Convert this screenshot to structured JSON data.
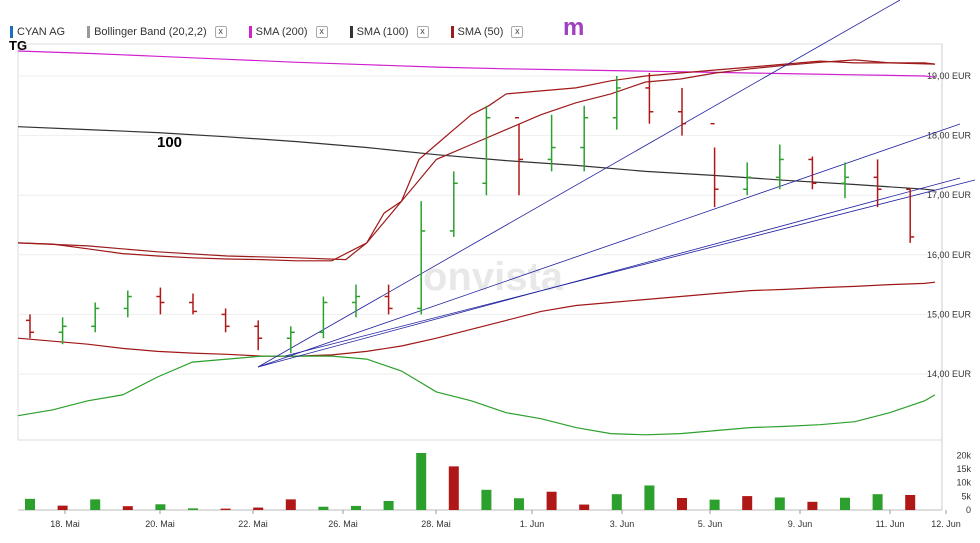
{
  "legend": {
    "ticker": {
      "label": "CYAN AG",
      "color": "#1a6fc4"
    },
    "bollinger": {
      "label": "Bollinger Band (20,2,2)",
      "color": "#999999",
      "close": "x"
    },
    "sma200": {
      "label": "SMA (200)",
      "color": "#d020d0",
      "close": "x"
    },
    "sma100": {
      "label": "SMA (100)",
      "color": "#333333",
      "close": "x"
    },
    "sma50": {
      "label": "SMA (50)",
      "color": "#9b1c1c",
      "close": "x"
    }
  },
  "logo_text": "m",
  "watermark": "onvista",
  "annotations": {
    "tg": "TG",
    "sma100_label": "100"
  },
  "chart_data": {
    "type": "ohlc",
    "x": [
      "16.05",
      "17.05",
      "18.05",
      "19.05",
      "20.05",
      "21.05",
      "22.05",
      "23.05",
      "24.05",
      "25.05",
      "26.05",
      "27.05",
      "28.05",
      "29.05",
      "30.05",
      "31.05",
      "01.06",
      "02.06",
      "03.06",
      "04.06",
      "05.06",
      "06.06",
      "07.06",
      "08.06",
      "09.06",
      "10.06",
      "11.06",
      "12.06"
    ],
    "x_ticks": [
      "18. Mai",
      "20. Mai",
      "22. Mai",
      "26. Mai",
      "28. Mai",
      "1. Jun",
      "3. Jun",
      "5. Jun",
      "9. Jun",
      "11. Jun",
      "12. Jun"
    ],
    "y_ticks": [
      "19,00 EUR",
      "18,00 EUR",
      "17,00 EUR",
      "16,00 EUR",
      "15,00 EUR",
      "14,00 EUR"
    ],
    "ylim": [
      13.0,
      19.3
    ],
    "volume_ticks": [
      "20k",
      "15k",
      "10k",
      "5k",
      "0"
    ],
    "volume_ylim": [
      0,
      22000
    ],
    "colors": {
      "up": "#2ca02c",
      "down": "#b01818"
    },
    "series": [
      {
        "name": "SMA (200)",
        "color": "#d020d0",
        "values": [
          [
            16.0,
            19.42
          ],
          [
            18.0,
            19.38
          ],
          [
            20.0,
            19.33
          ],
          [
            22.0,
            19.28
          ],
          [
            24.0,
            19.23
          ],
          [
            26.0,
            19.19
          ],
          [
            28.0,
            19.15
          ],
          [
            30.0,
            19.12
          ],
          [
            1.0,
            19.1
          ],
          [
            3.0,
            19.08
          ],
          [
            5.0,
            19.06
          ],
          [
            7.0,
            19.04
          ],
          [
            9.0,
            19.02
          ],
          [
            11.0,
            19.0
          ],
          [
            11.3,
            18.98
          ]
        ]
      },
      {
        "name": "SMA (100)",
        "color": "#333333",
        "values": [
          [
            16.0,
            18.15
          ],
          [
            18.0,
            18.1
          ],
          [
            20.0,
            18.05
          ],
          [
            22.0,
            17.98
          ],
          [
            24.0,
            17.9
          ],
          [
            26.0,
            17.8
          ],
          [
            28.0,
            17.68
          ],
          [
            30.0,
            17.58
          ],
          [
            1.0,
            17.5
          ],
          [
            3.0,
            17.4
          ],
          [
            5.0,
            17.33
          ],
          [
            7.0,
            17.25
          ],
          [
            9.0,
            17.18
          ],
          [
            11.0,
            17.1
          ],
          [
            11.3,
            17.08
          ]
        ]
      },
      {
        "name": "SMA (50)",
        "color": "#9b1c1c",
        "values": [
          [
            16.0,
            16.2
          ],
          [
            18.0,
            16.15
          ],
          [
            20.0,
            16.05
          ],
          [
            22.0,
            15.98
          ],
          [
            24.0,
            15.95
          ],
          [
            25.4,
            15.92
          ],
          [
            26.0,
            16.2
          ],
          [
            27.0,
            16.9
          ],
          [
            28.0,
            17.6
          ],
          [
            29.0,
            17.85
          ],
          [
            30.0,
            18.1
          ],
          [
            31.0,
            18.35
          ],
          [
            1.0,
            18.55
          ],
          [
            2.0,
            18.7
          ],
          [
            3.0,
            18.9
          ],
          [
            4.0,
            18.95
          ],
          [
            5.0,
            19.05
          ],
          [
            6.0,
            19.12
          ],
          [
            7.0,
            19.18
          ],
          [
            8.0,
            19.23
          ],
          [
            9.0,
            19.27
          ],
          [
            10.0,
            19.22
          ],
          [
            11.0,
            19.22
          ],
          [
            11.3,
            19.2
          ]
        ]
      },
      {
        "name": "Bollinger Upper",
        "color": "#a01818",
        "values": [
          [
            16.0,
            16.2
          ],
          [
            17.0,
            16.18
          ],
          [
            18.0,
            16.1
          ],
          [
            19.0,
            16.02
          ],
          [
            20.0,
            15.98
          ],
          [
            21.0,
            15.95
          ],
          [
            22.0,
            15.93
          ],
          [
            23.0,
            15.92
          ],
          [
            24.0,
            15.9
          ],
          [
            25.0,
            15.9
          ],
          [
            26.0,
            16.2
          ],
          [
            26.5,
            16.7
          ],
          [
            27.0,
            16.9
          ],
          [
            27.5,
            17.6
          ],
          [
            28.0,
            17.85
          ],
          [
            28.5,
            18.1
          ],
          [
            29.0,
            18.35
          ],
          [
            29.5,
            18.5
          ],
          [
            30.0,
            18.7
          ],
          [
            31.0,
            18.75
          ],
          [
            1.0,
            18.8
          ],
          [
            2.0,
            18.92
          ],
          [
            3.0,
            19.0
          ],
          [
            4.0,
            19.05
          ],
          [
            5.0,
            19.1
          ],
          [
            6.0,
            19.15
          ],
          [
            7.0,
            19.2
          ],
          [
            8.0,
            19.25
          ],
          [
            9.0,
            19.22
          ],
          [
            10.0,
            19.22
          ],
          [
            11.3,
            19.2
          ]
        ]
      },
      {
        "name": "Bollinger Lower",
        "color": "#a01818",
        "values": [
          [
            16.0,
            14.6
          ],
          [
            17.0,
            14.55
          ],
          [
            18.0,
            14.5
          ],
          [
            19.0,
            14.43
          ],
          [
            20.0,
            14.38
          ],
          [
            21.0,
            14.35
          ],
          [
            22.0,
            14.33
          ],
          [
            23.0,
            14.3
          ],
          [
            24.0,
            14.3
          ],
          [
            25.0,
            14.32
          ],
          [
            26.0,
            14.38
          ],
          [
            27.0,
            14.47
          ],
          [
            28.0,
            14.6
          ],
          [
            29.0,
            14.75
          ],
          [
            30.0,
            14.9
          ],
          [
            31.0,
            15.05
          ],
          [
            1.0,
            15.15
          ],
          [
            2.0,
            15.2
          ],
          [
            3.0,
            15.25
          ],
          [
            4.0,
            15.3
          ],
          [
            5.0,
            15.35
          ],
          [
            6.0,
            15.4
          ],
          [
            7.0,
            15.42
          ],
          [
            8.0,
            15.45
          ],
          [
            9.0,
            15.47
          ],
          [
            10.0,
            15.5
          ],
          [
            11.0,
            15.52
          ],
          [
            11.3,
            15.54
          ]
        ]
      },
      {
        "name": "Bollinger Middle",
        "color": "#2ca02c",
        "values": [
          [
            16.0,
            13.3
          ],
          [
            17.0,
            13.4
          ],
          [
            18.0,
            13.55
          ],
          [
            19.0,
            13.65
          ],
          [
            20.0,
            13.95
          ],
          [
            21.0,
            14.2
          ],
          [
            22.0,
            14.25
          ],
          [
            23.0,
            14.3
          ],
          [
            24.0,
            14.3
          ],
          [
            25.0,
            14.3
          ],
          [
            26.0,
            14.25
          ],
          [
            27.0,
            14.05
          ],
          [
            28.0,
            13.7
          ],
          [
            29.0,
            13.55
          ],
          [
            30.0,
            13.35
          ],
          [
            31.0,
            13.25
          ],
          [
            1.0,
            13.1
          ],
          [
            2.0,
            13.0
          ],
          [
            3.0,
            12.98
          ],
          [
            4.0,
            13.0
          ],
          [
            5.0,
            13.05
          ],
          [
            6.0,
            13.1
          ],
          [
            7.0,
            13.12
          ],
          [
            8.0,
            13.15
          ],
          [
            9.0,
            13.2
          ],
          [
            10.0,
            13.35
          ],
          [
            11.0,
            13.55
          ],
          [
            11.3,
            13.65
          ]
        ]
      }
    ],
    "ohlc": [
      [
        14.9,
        15.0,
        14.6,
        14.7
      ],
      [
        14.7,
        14.95,
        14.5,
        14.8
      ],
      [
        14.8,
        15.2,
        14.7,
        15.1
      ],
      [
        15.1,
        15.4,
        14.95,
        15.3
      ],
      [
        15.3,
        15.45,
        15.0,
        15.2
      ],
      [
        15.2,
        15.35,
        15.0,
        15.05
      ],
      [
        15.0,
        15.1,
        14.7,
        14.8
      ],
      [
        14.8,
        14.9,
        14.4,
        14.6
      ],
      [
        14.6,
        14.8,
        14.35,
        14.7
      ],
      [
        14.7,
        15.3,
        14.6,
        15.2
      ],
      [
        15.2,
        15.5,
        14.95,
        15.3
      ],
      [
        15.3,
        15.5,
        15.0,
        15.1
      ],
      [
        15.1,
        16.9,
        15.0,
        16.4
      ],
      [
        16.4,
        17.4,
        16.3,
        17.2
      ],
      [
        17.2,
        18.5,
        17.0,
        18.3
      ],
      [
        18.3,
        18.2,
        17.0,
        17.6
      ],
      [
        17.6,
        18.35,
        17.4,
        17.8
      ],
      [
        17.8,
        18.5,
        17.4,
        18.3
      ],
      [
        18.3,
        19.0,
        18.1,
        18.8
      ],
      [
        18.8,
        19.05,
        18.2,
        18.4
      ],
      [
        18.4,
        18.8,
        18.0,
        18.2
      ],
      [
        18.2,
        17.8,
        16.8,
        17.1
      ],
      [
        17.1,
        17.55,
        17.0,
        17.3
      ],
      [
        17.3,
        17.85,
        17.1,
        17.6
      ],
      [
        17.6,
        17.65,
        17.1,
        17.2
      ],
      [
        17.2,
        17.55,
        16.95,
        17.3
      ],
      [
        17.3,
        17.6,
        16.8,
        17.1
      ],
      [
        17.1,
        17.1,
        16.2,
        16.3
      ]
    ],
    "volume": [
      4100,
      1600,
      3900,
      1400,
      2100,
      600,
      500,
      900,
      3900,
      1200,
      1500,
      3300,
      20900,
      16000,
      7400,
      4300,
      6700,
      2000,
      5800,
      9000,
      4400,
      3800,
      5100,
      4600,
      3000,
      4500,
      5800,
      5500
    ],
    "volume_up": [
      true,
      false,
      true,
      false,
      true,
      true,
      false,
      false,
      false,
      true,
      true,
      true,
      true,
      false,
      true,
      true,
      false,
      false,
      true,
      true,
      false,
      true,
      false,
      true,
      false,
      true,
      true,
      false
    ]
  }
}
